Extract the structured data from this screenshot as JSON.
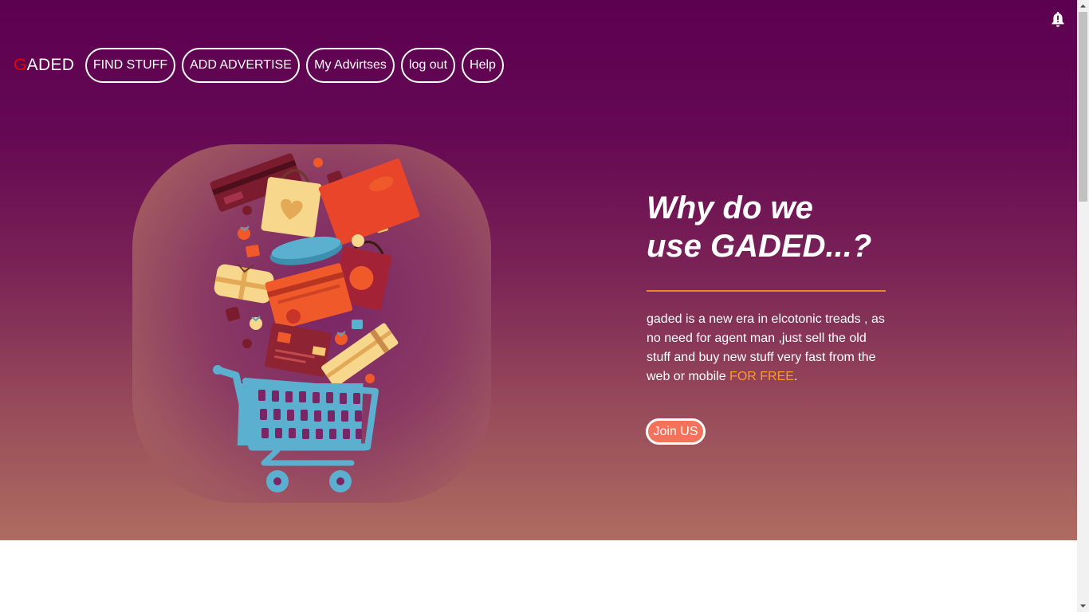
{
  "brand": {
    "logo_first_letter": "G",
    "logo_rest": "ADED",
    "logo_first_color": "#e60000"
  },
  "header": {
    "notification_icon": "bell-alert-icon"
  },
  "nav": {
    "items": [
      {
        "label": "FIND STUFF"
      },
      {
        "label": "ADD ADVERTISE"
      },
      {
        "label": "My Advirtses"
      },
      {
        "label": "log out"
      },
      {
        "label": "Help"
      }
    ]
  },
  "hero": {
    "illustration": "shopping-cart-illustration",
    "heading_line1": "Why do we",
    "heading_line2": "use GADED...?",
    "description_main": "gaded is a new era in elcotonic treads , as no need for agent man ,just sell the old stuff and buy new stuff very fast from the web or mobile ",
    "description_highlight": "FOR FREE",
    "description_end": ".",
    "join_button": "Join US",
    "accent_color": "#e48a2a",
    "highlight_color": "#ff9c1f",
    "button_color": "#f4715a"
  },
  "colors": {
    "hero_top": "#5c0050",
    "hero_bottom": "#ae6c60"
  }
}
